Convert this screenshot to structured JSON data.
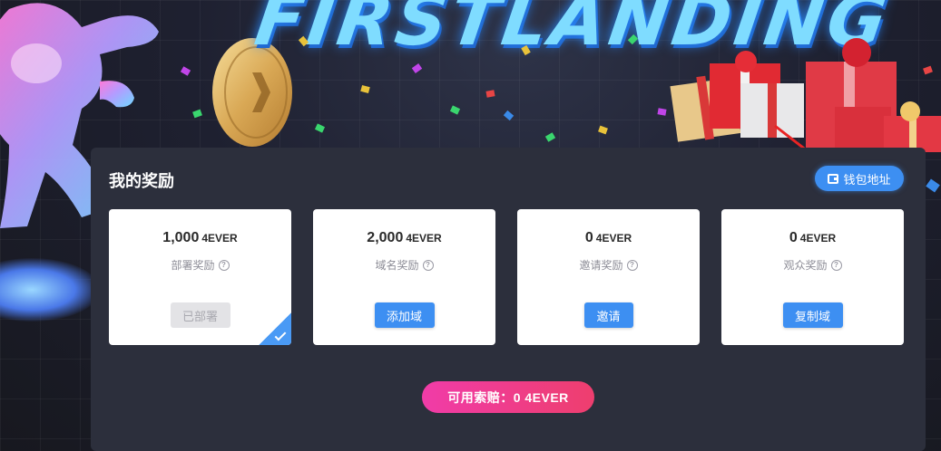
{
  "banner": {
    "title": "FIRSTLANDING"
  },
  "panel": {
    "title": "我的奖励",
    "wallet_button": {
      "label": "钱包地址",
      "icon": "wallet-icon"
    }
  },
  "cards": [
    {
      "amount": "1,000",
      "unit": "4EVER",
      "label": "部署奖励",
      "button": "已部署",
      "button_state": "disabled",
      "completed": true
    },
    {
      "amount": "2,000",
      "unit": "4EVER",
      "label": "域名奖励",
      "button": "添加域",
      "button_state": "primary",
      "completed": false
    },
    {
      "amount": "0",
      "unit": "4EVER",
      "label": "邀请奖励",
      "button": "邀请",
      "button_state": "primary",
      "completed": false
    },
    {
      "amount": "0",
      "unit": "4EVER",
      "label": "观众奖励",
      "button": "复制域",
      "button_state": "primary",
      "completed": false
    }
  ],
  "claim": {
    "label": "可用索赔：0 4EVER"
  },
  "colors": {
    "primary": "#3d8ff2",
    "panel": "#2c2f3c",
    "claim_start": "#f03ca8",
    "claim_end": "#ee3e6e"
  }
}
